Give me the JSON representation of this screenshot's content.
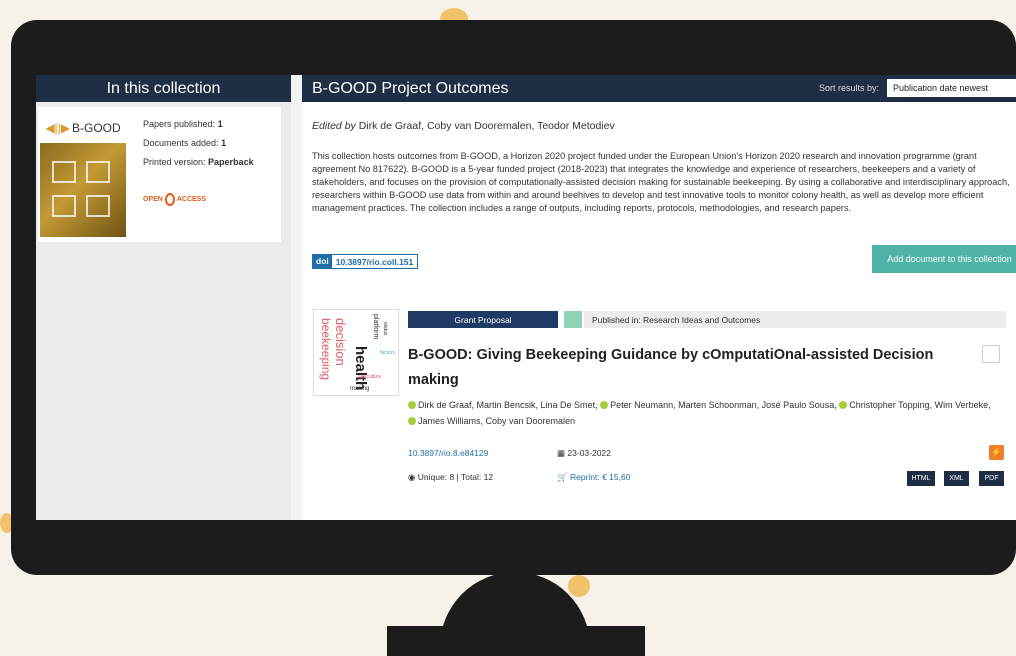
{
  "left_panel": {
    "heading": "In this collection",
    "logo_text": "B-GOOD",
    "papers_label": "Papers published:",
    "papers_value": "1",
    "documents_label": "Documents added:",
    "documents_value": "1",
    "printed_label": "Printed version:",
    "printed_value": "Paperback",
    "open_access_prefix": "OPEN",
    "open_access_suffix": "ACCESS"
  },
  "main": {
    "title": "B-GOOD Project Outcomes",
    "sort_label": "Sort results by:",
    "sort_value": "Publication date newest",
    "edited_by_label": "Edited by",
    "editors": "Dirk de Graaf, Coby van Dooremalen, Teodor Metodiev",
    "description": "This collection hosts outcomes from B-GOOD, a Horizon 2020 project funded under the European Union's Horizon 2020 research and innovation programme (grant agreement No 817622). B-GOOD is a 5-year funded project (2018-2023) that integrates the knowledge and experience of researchers, beekeepers and a variety of stakeholders, and focuses on the provision of computationally-assisted decision making for sustainable beekeeping. By using a collaborative and interdisciplinary approach, researchers within B-GOOD use data from within and around beehives to develop and test innovative tools to monitor colony health, as well as develop more efficient management practices. The collection includes a range of outputs, including reports, protocols, methodologies, and research papers.",
    "doi_tag": "doi",
    "doi_value": "10.3897/rio.coll.151",
    "add_button": "Add document to this collection"
  },
  "article": {
    "type_badge": "Grant Proposal",
    "published_in": "Published in: Research Ideas and Outcomes",
    "title": "B-GOOD: Giving Beekeeping Guidance by cOmputatiOnal-assisted Decision making",
    "authors_line1": "Dirk de Graaf, Martin Bencsik, Lina De Smet,",
    "authors_line2": "Peter Neumann, Marten Schoonman, José Paulo Sousa,",
    "authors_line3": "Christopher Topping, Wim Verbeke,",
    "authors_line4": "James Williams, Coby van Dooremalen",
    "doi": "10.3897/rio.8.e84129",
    "date": "23-03-2022",
    "views": "Unique: 8 | Total: 12",
    "reprint": "Reprint: € 15,60",
    "formats": [
      "HTML",
      "XML",
      "PDF"
    ],
    "wordcloud": [
      "health",
      "decision",
      "beekeeping",
      "platform",
      "making",
      "agriculture",
      "factors",
      "status"
    ]
  }
}
